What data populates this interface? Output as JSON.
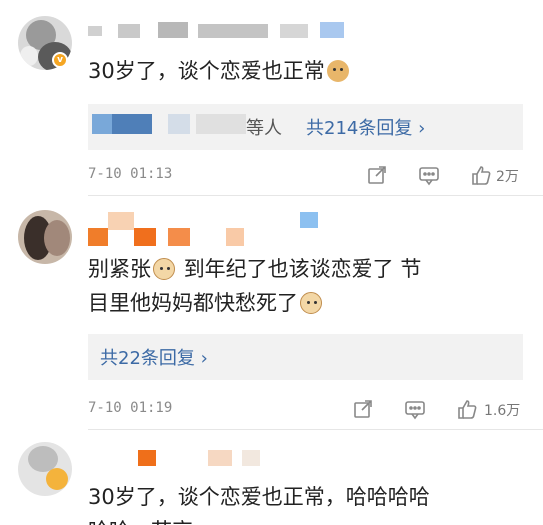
{
  "comments": [
    {
      "content": "30岁了，谈个恋爱也正常",
      "replies": {
        "prefix": "等人",
        "link": "共214条回复 ›"
      },
      "time": "7-10 01:13",
      "likes": "2万"
    },
    {
      "content_a": "别紧张",
      "content_b": "到年纪了也该谈恋爱了 节",
      "content_c": "目里他妈妈都快愁死了",
      "replies": {
        "link": "共22条回复 ›"
      },
      "time": "7-10 01:19",
      "likes": "1.6万"
    },
    {
      "content_a": "30岁了，谈个恋爱也正常，哈哈哈哈",
      "content_b": "哈哈，节哀"
    }
  ],
  "colors": {
    "link": "#3c6aa5",
    "badge": "#f5a623",
    "muted": "#8a8a8a"
  }
}
